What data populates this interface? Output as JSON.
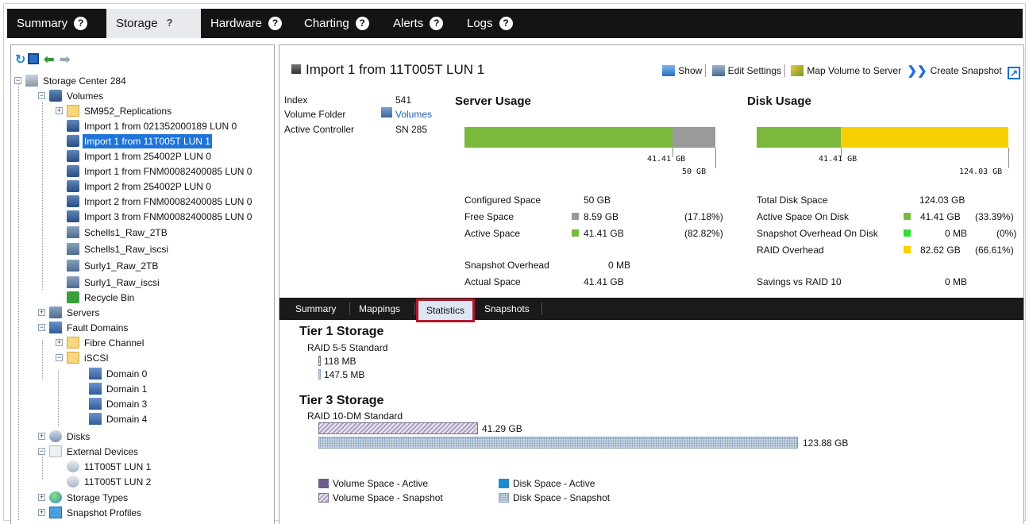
{
  "top_tabs": [
    {
      "label": "Summary"
    },
    {
      "label": "Storage",
      "active": true
    },
    {
      "label": "Hardware"
    },
    {
      "label": "Charting"
    },
    {
      "label": "Alerts"
    },
    {
      "label": "Logs"
    }
  ],
  "help_glyph": "?",
  "tree": {
    "root": "Storage Center 284",
    "volumes": "Volumes",
    "volume_items": [
      "SM952_Replications",
      "Import 1 from 021352000189 LUN 0",
      "Import 1 from 11T005T LUN 1",
      "Import 1 from 254002P LUN 0",
      "Import 1 from FNM00082400085 LUN 0",
      "Import 2 from 254002P LUN 0",
      "Import 2 from FNM00082400085 LUN 0",
      "Import 3 from FNM00082400085 LUN 0",
      "Schells1_Raw_2TB",
      "Schells1_Raw_iscsi",
      "Surly1_Raw_2TB",
      "Surly1_Raw_iscsi",
      "Recycle Bin"
    ],
    "servers": "Servers",
    "fault_domains": "Fault Domains",
    "fibre_channel": "Fibre Channel",
    "iscsi": "iSCSI",
    "domains": [
      "Domain 0",
      "Domain 1",
      "Domain 3",
      "Domain 4"
    ],
    "disks": "Disks",
    "external_devices": "External Devices",
    "ext_items": [
      "11T005T LUN 1",
      "11T005T LUN 2"
    ],
    "storage_types": "Storage Types",
    "snapshot_profiles": "Snapshot Profiles"
  },
  "volume": {
    "title": "Import 1 from 11T005T LUN 1",
    "actions": {
      "show": "Show",
      "edit": "Edit Settings",
      "map": "Map Volume to Server",
      "snapshot": "Create Snapshot"
    },
    "info": {
      "index_label": "Index",
      "index_value": "541",
      "folder_label": "Volume Folder",
      "folder_value": "Volumes",
      "controller_label": "Active Controller",
      "controller_value": "SN 285"
    }
  },
  "server_usage": {
    "heading": "Server Usage",
    "used_fraction": 0.8282,
    "used_label": "41.41 GB",
    "total_label": "50 GB",
    "configured_label": "Configured Space",
    "configured_value": "50 GB",
    "free_label": "Free Space",
    "free_value": "8.59 GB",
    "free_pct": "(17.18%)",
    "active_label": "Active Space",
    "active_value": "41.41 GB",
    "active_pct": "(82.82%)",
    "overhead_label": "Snapshot Overhead",
    "overhead_value": "0 MB",
    "actual_label": "Actual Space",
    "actual_value": "41.41 GB"
  },
  "disk_usage": {
    "heading": "Disk Usage",
    "used_fraction": 0.3339,
    "used_label": "41.41 GB",
    "total_label": "124.03 GB",
    "total_disk_label": "Total Disk Space",
    "total_disk_value": "124.03 GB",
    "active_label": "Active Space On Disk",
    "active_value": "41.41 GB",
    "active_pct": "(33.39%)",
    "snap_label": "Snapshot Overhead On Disk",
    "snap_value": "0 MB",
    "snap_pct": "(0%)",
    "raid_label": "RAID Overhead",
    "raid_value": "82.62 GB",
    "raid_pct": "(66.61%)",
    "savings_label": "Savings vs RAID 10",
    "savings_value": "0 MB"
  },
  "colors": {
    "active": "#7ab93d",
    "free": "#9a9a9a",
    "snapshot": "#33dd33",
    "raid": "#f7d000",
    "disk_active": "#1e8ad0",
    "volume_active": "#6e5d8c"
  },
  "sub_tabs": [
    "Summary",
    "Mappings",
    "Statistics",
    "Snapshots"
  ],
  "stats": {
    "tier1": {
      "heading": "Tier 1 Storage",
      "raid": "RAID 5-5 Standard",
      "v1": "118 MB",
      "v2": "147.5 MB"
    },
    "tier3": {
      "heading": "Tier 3 Storage",
      "raid": "RAID 10-DM Standard",
      "v1": "41.29 GB",
      "v2": "123.88 GB"
    },
    "legend": {
      "vol_active": "Volume Space - Active",
      "vol_snap": "Volume Space - Snapshot",
      "disk_active": "Disk Space - Active",
      "disk_snap": "Disk Space - Snapshot"
    }
  }
}
